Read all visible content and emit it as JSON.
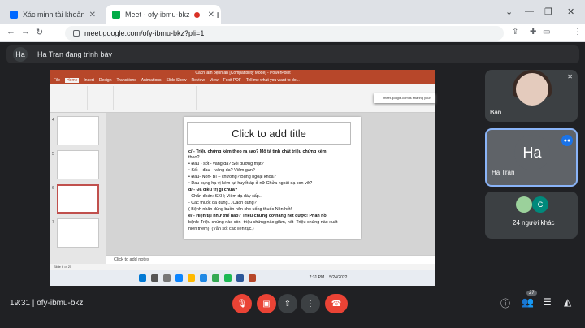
{
  "tabs": [
    {
      "title": "Xác minh tài khoản Zalo",
      "icon": "zalo-icon",
      "color": "#0068ff"
    },
    {
      "title": "Meet - ofy-ibmu-bkz",
      "icon": "meet-icon",
      "color": "#00ac47"
    }
  ],
  "address": {
    "url": "meet.google.com/ofy-ibmu-bkz?pli=1"
  },
  "presenter_bar": {
    "avatar": "Ha",
    "text": "Ha Tran đang trình bày"
  },
  "ppt": {
    "window_title": "Cách làm bệnh án [Compatibility Mode] - PowerPoint",
    "ribbon_tabs": [
      "File",
      "Home",
      "Insert",
      "Design",
      "Transitions",
      "Animations",
      "Slide Show",
      "Review",
      "View",
      "Foxit PDF",
      "Tell me what you want to do..."
    ],
    "share_popup": "meet.google.com is sharing your",
    "slide_title": "Click to add title",
    "body_lines": [
      "c/ - Triệu chứng kèm theo ra sao? Mô tả tính chất triệu chứng kèm",
      "theo?",
      "•   Đau - sốt - vàng da?        Sỏi đường mật?",
      "•   Sốt – đau – vàng da?           Viêm gan?",
      "•   Đau- Nôn- Bí – chướng?              Bụng ngoại khoa?",
      "•   Đau bụng hạ vị kèm tụt huyết áp ở nữ      Chửa ngoài dạ con vỡ?",
      "d/ - Đã điều trị gì chưa?",
      "     - Chẩn đoán: SXH; Viêm dạ dày cấp...",
      "     - Các thuốc đã dùng... Cách dùng?",
      "        ( Bệnh nhân dùng buồn nôn cho uống thuốc           Nôn hết!",
      "e/ - Hiện tại như thế nào? Triệu chứng cơ năng hết được! Phản hồi",
      "bệnh: Triệu chứng nào còn- triệu chứng nào giảm, hết- Triệu chứng nào xuất",
      "hiện thêm). (Vẫn sốt cao liên tục.)"
    ],
    "notes": "Click to add notes",
    "status": "Slide 6 of 25",
    "slide_numbers": [
      "4",
      "5",
      "6",
      "7"
    ],
    "clock_time": "7:31 PM",
    "clock_date": "5/24/2022"
  },
  "participants": [
    {
      "name": "Bạn"
    },
    {
      "name": "Ha Tran",
      "initials": "Ha"
    },
    {
      "name": "24 người khác",
      "initials": "C"
    }
  ],
  "bottom": {
    "time": "19:31",
    "code": "ofy-ibmu-bkz",
    "participant_count": "27"
  }
}
